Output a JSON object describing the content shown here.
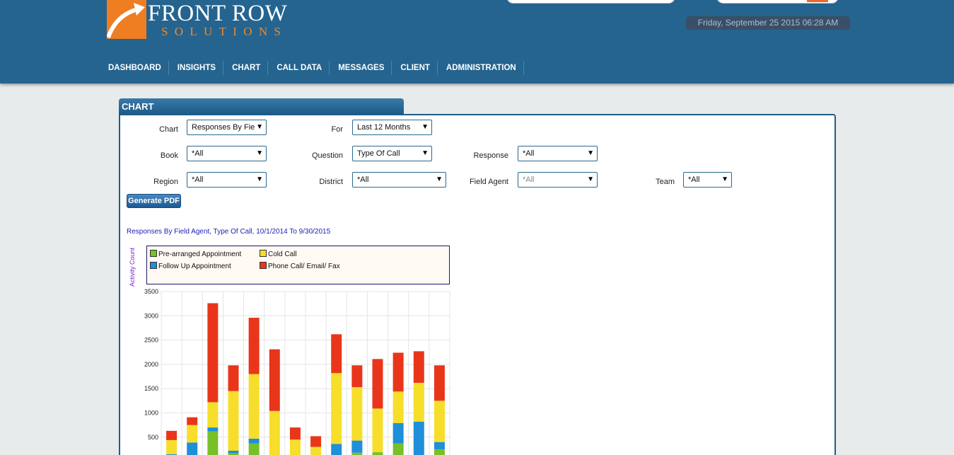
{
  "brand": {
    "line1": "Front Row",
    "line2": "Solutions"
  },
  "datetime": "Friday, September 25 2015 06:28 AM",
  "nav": [
    "DASHBOARD",
    "INSIGHTS",
    "CHART",
    "CALL DATA",
    "MESSAGES",
    "CLIENT",
    "ADMINISTRATION"
  ],
  "panel_title": "CHART",
  "filters": {
    "chart": {
      "label": "Chart",
      "value": "Responses By Fie"
    },
    "for": {
      "label": "For",
      "value": "Last 12 Months"
    },
    "book": {
      "label": "Book",
      "value": "*All"
    },
    "question": {
      "label": "Question",
      "value": "Type Of Call"
    },
    "response": {
      "label": "Response",
      "value": "*All"
    },
    "region": {
      "label": "Region",
      "value": "*All"
    },
    "district": {
      "label": "District",
      "value": "*All"
    },
    "field_agent": {
      "label": "Field Agent",
      "value": "*All"
    },
    "team": {
      "label": "Team",
      "value": "*All"
    }
  },
  "generate_pdf": "Generate PDF",
  "colors": {
    "header": "#24648f",
    "accent": "#ef8a2b"
  },
  "chart_data": {
    "type": "bar",
    "stacked": true,
    "title": "Responses By Field Agent, Type Of Call, 10/1/2014 To 9/30/2015",
    "ylabel": "Activity Count",
    "xlabel": "",
    "ylim": [
      0,
      3500
    ],
    "yticks": [
      500,
      1000,
      1500,
      2000,
      2500,
      3000,
      3500
    ],
    "grid": true,
    "legend_position": "top",
    "series": [
      {
        "name": "Pre-arranged Appointment",
        "color": "#77c028",
        "values": [
          50,
          60,
          620,
          170,
          370,
          40,
          50,
          20,
          30,
          180,
          190,
          370,
          60,
          250
        ]
      },
      {
        "name": "Follow Up Appointment",
        "color": "#1e8fd8",
        "values": [
          100,
          330,
          80,
          50,
          100,
          0,
          60,
          0,
          330,
          250,
          0,
          420,
          760,
          150
        ]
      },
      {
        "name": "Cold Call",
        "color": "#f6de2b",
        "values": [
          290,
          360,
          520,
          1230,
          1330,
          1000,
          340,
          280,
          1460,
          1100,
          900,
          650,
          800,
          850
        ]
      },
      {
        "name": "Phone Call/ Email/ Fax",
        "color": "#e9361a",
        "values": [
          190,
          160,
          2040,
          530,
          1160,
          1270,
          250,
          220,
          800,
          450,
          1020,
          800,
          650,
          730
        ]
      }
    ]
  }
}
